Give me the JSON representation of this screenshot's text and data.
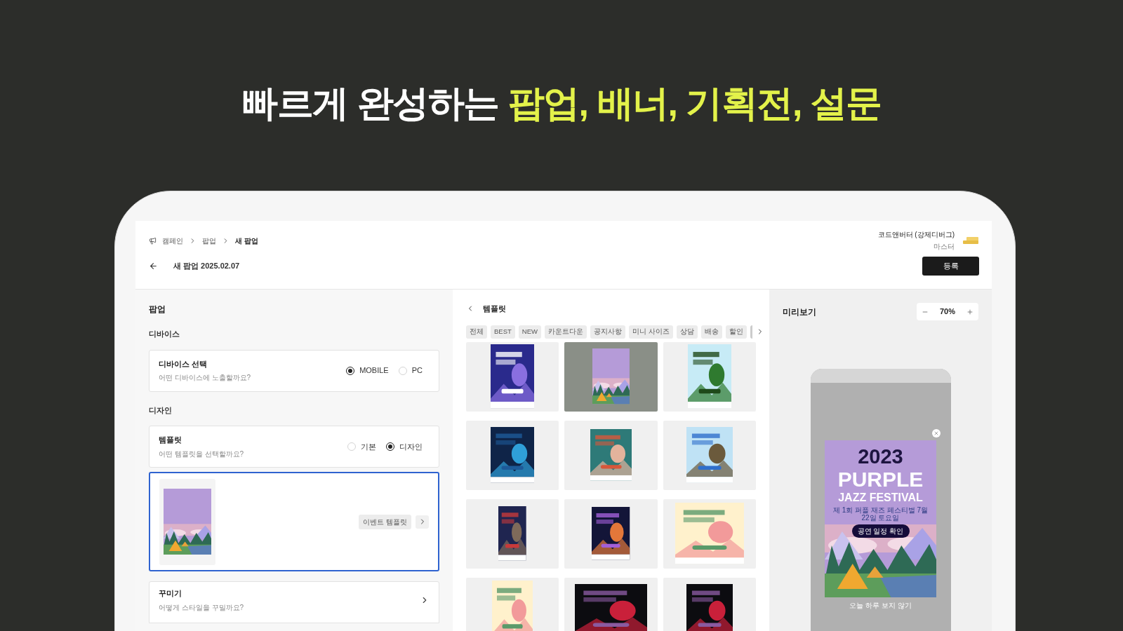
{
  "headline": {
    "text": "빠르게 완성하는",
    "highlight": "팝업, 배너, 기획전, 설문"
  },
  "breadcrumb": [
    "캠페인",
    "팝업",
    "새 팝업"
  ],
  "page_title": "새 팝업 2025.02.07",
  "user": {
    "name": "코드앤버터 (강제디버그)",
    "role": "마스터"
  },
  "register_button": "등록",
  "settings": {
    "title": "팝업",
    "sections": [
      {
        "heading": "디바이스",
        "cards": [
          {
            "kind": "radio",
            "title": "디바이스 선택",
            "description": "어떤 디바이스에 노출할까요?",
            "options": [
              {
                "label": "MOBILE",
                "selected": true
              },
              {
                "label": "PC",
                "selected": false
              }
            ]
          }
        ]
      },
      {
        "heading": "디자인",
        "cards": [
          {
            "kind": "radio",
            "title": "템플릿",
            "description": "어떤 템플릿을 선택할까요?",
            "options": [
              {
                "label": "기본",
                "selected": false
              },
              {
                "label": "디자인",
                "selected": true
              }
            ]
          },
          {
            "kind": "template",
            "selected": true,
            "tag": "이벤트 템플릿"
          },
          {
            "kind": "link",
            "title": "꾸미기",
            "description": "어떻게 스타일을 꾸밀까요?"
          }
        ]
      }
    ]
  },
  "templates": {
    "title": "템플릿",
    "categories": [
      "전체",
      "BEST",
      "NEW",
      "카운트다운",
      "공지사항",
      "미니 사이즈",
      "상담",
      "배송",
      "할인"
    ],
    "items": [
      {
        "selected": false
      },
      {
        "selected": true
      },
      {
        "selected": false
      },
      {
        "selected": false
      },
      {
        "selected": false
      },
      {
        "selected": false
      },
      {
        "selected": false
      },
      {
        "selected": false
      },
      {
        "selected": false
      },
      {
        "selected": false
      },
      {
        "selected": false
      },
      {
        "selected": false
      }
    ]
  },
  "preview": {
    "title": "미리보기",
    "zoom": "70%",
    "popup": {
      "year": "2023",
      "title": "PURPLE",
      "subtitle": "JAZZ FESTIVAL",
      "info": "제 1회 퍼플 재즈 페스티벌 7월 22일 토요일",
      "button": "공연 일정 확인",
      "dismiss": "오늘 하루 보지 않기"
    }
  }
}
